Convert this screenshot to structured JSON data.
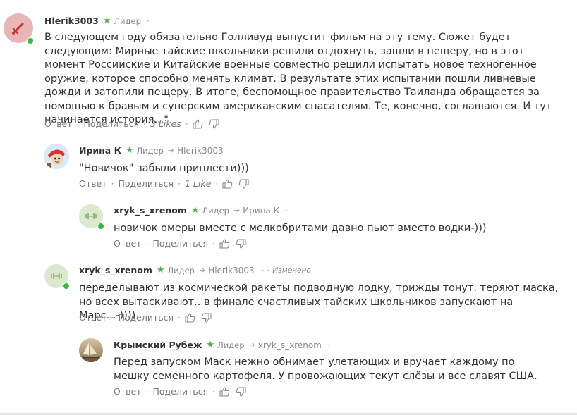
{
  "comments": [
    {
      "author": "Hlerik3003",
      "role": "Лидер",
      "menu": "·",
      "text": "В следующем году обязательно Голливуд выпустит фильм на эту тему. Сюжет будет следующим: Мирные тайские школьники решили отдохнуть, зашли в пещеру, но в этот момент Российские и Китайские военные совместно решили испытать новое техногенное оружие, которое способно менять климат. В результате этих испытаний пошли ливневые дожди и затопили пещеру. В итоге, беспомощное правительство Таиланда обращается за помощью к бравым и суперским американским спасателям. Те, конечно, соглашаются. И тут начинается история...\"",
      "reply": "Ответ",
      "share": "Поделиться",
      "likes": "3 Likes",
      "avatar_color": "#e8b6b6",
      "avatar_icon": "sword-icon"
    },
    {
      "author": "Ирина К",
      "role": "Лидер",
      "reply_to": "Hlerik3003",
      "text": "\"Новичок\" забыли приплести)))",
      "reply": "Ответ",
      "share": "Поделиться",
      "likes": "1 Like",
      "avatar_icon": "cartoon-avatar"
    },
    {
      "author": "xryk_s_xrenom",
      "role": "Лидер",
      "reply_to": "Ирина К",
      "menu": "·",
      "text": "новичок омеры вместе с мелкобритами давно пьют вместо водки-)))",
      "reply": "Ответ",
      "share": "Поделиться",
      "avatar_color": "#dde8d0",
      "avatar_icon": "dumbbell-icon"
    },
    {
      "author": "xryk_s_xrenom",
      "role": "Лидер",
      "reply_to": "Hlerik3003",
      "menu": "·",
      "edited": "Изменено",
      "text": "переделывают из космической ракеты подводную лодку, трижды тонут. теряют маска, но всех вытаскивают.. в финале счастливых тайских школьников запускают на Марс...-))))",
      "reply": "Ответ",
      "share": "Поделиться",
      "avatar_color": "#dde8d0",
      "avatar_icon": "dumbbell-icon"
    },
    {
      "author": "Крымский Рубеж",
      "role": "Лидер",
      "reply_to": "xryk_s_xrenom",
      "menu": "·",
      "text": "Перед запуском Маск нежно обнимает улетающих и вручает каждому по мешку семенного картофеля. У провожающих текут слёзы и все славят США.",
      "reply": "Ответ",
      "share": "Поделиться",
      "avatar_icon": "sailboat-photo"
    }
  ],
  "colors": {
    "star": "#4caf50",
    "online": "#3cb54a",
    "meta": "#888888",
    "text": "#333333"
  }
}
